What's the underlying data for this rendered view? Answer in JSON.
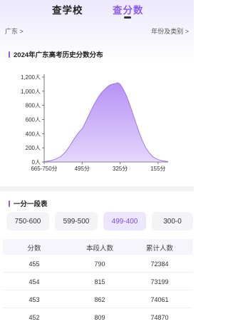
{
  "tabs": [
    "查学校",
    "查分数"
  ],
  "filters": {
    "region": "广东 >",
    "year_category": "年份及类别 >"
  },
  "chart_data": {
    "type": "area",
    "title": "2024年广东高考历史分数分布",
    "x_tick_labels": [
      "665-750分",
      "495分",
      "325分",
      "155分"
    ],
    "y_tick_labels": [
      "0人",
      "200人",
      "400人",
      "600人",
      "800人",
      "1,000人",
      "1,200人"
    ],
    "ylim": [
      0,
      1200
    ],
    "x": [
      665,
      640,
      615,
      590,
      570,
      550,
      530,
      510,
      495,
      480,
      465,
      450,
      435,
      420,
      405,
      390,
      375,
      360,
      345,
      335,
      325,
      315,
      300,
      285,
      270,
      255,
      240,
      225,
      210,
      195,
      180,
      170,
      155,
      140,
      125,
      110
    ],
    "values": [
      5,
      15,
      40,
      80,
      140,
      230,
      330,
      420,
      470,
      560,
      660,
      760,
      850,
      930,
      990,
      1040,
      1080,
      1100,
      1110,
      1120,
      1100,
      1050,
      960,
      840,
      700,
      560,
      420,
      300,
      200,
      130,
      80,
      55,
      35,
      20,
      12,
      5
    ],
    "color": "#b38cf5",
    "grid": false
  },
  "table_title": "一分一段表",
  "ranges": [
    "750-600",
    "599-500",
    "499-400",
    "300-0"
  ],
  "active_range": "499-400",
  "headers": [
    "分数",
    "本段人数",
    "累计人数"
  ],
  "rows": [
    [
      "455",
      "790",
      "72384"
    ],
    [
      "454",
      "815",
      "73199"
    ],
    [
      "453",
      "862",
      "74061"
    ],
    [
      "452",
      "809",
      "74870"
    ]
  ]
}
